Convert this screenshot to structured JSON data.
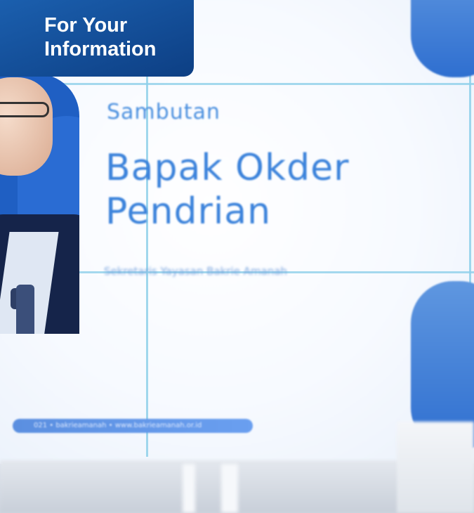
{
  "badge": {
    "line1": "For Your",
    "line2": "Information"
  },
  "screen": {
    "subtitle": "Sambutan",
    "name_line1": "Bapak Okder",
    "name_line2": "Pendrian",
    "role": "Sekretaris Yayasan Bakrie Amanah",
    "info_bar": "021 • bakrieamanah • www.bakrieamanah.or.id"
  },
  "colors": {
    "badge": "#0d3f84",
    "accent_text": "#3c83db",
    "screen_bg": "#f7faff"
  }
}
